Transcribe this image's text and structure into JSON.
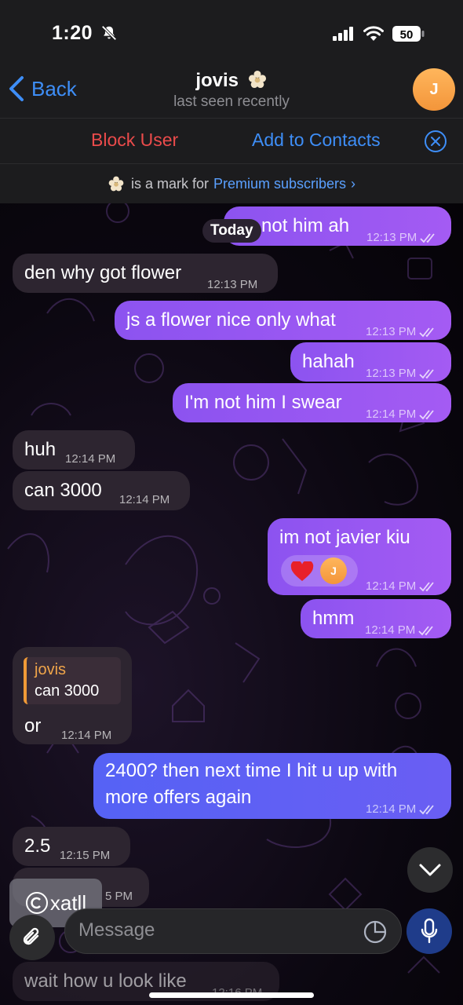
{
  "status_bar": {
    "time": "1:20",
    "battery": "50"
  },
  "header": {
    "back_label": "Back",
    "title": "jovis",
    "subtitle": "last seen recently",
    "avatar_initial": "J"
  },
  "actions": {
    "block": "Block User",
    "add": "Add to Contacts"
  },
  "premium": {
    "text": "is a mark for",
    "link": "Premium subscribers",
    "chevron": "›"
  },
  "chat": {
    "date_badge": "Today",
    "messages": [
      {
        "text": "not him ah",
        "time": "12:13 PM",
        "dir": "out"
      },
      {
        "text": "den why got flower",
        "time": "12:13 PM",
        "dir": "in"
      },
      {
        "text": "js a flower nice only what",
        "time": "12:13 PM",
        "dir": "out"
      },
      {
        "text": "hahah",
        "time": "12:13 PM",
        "dir": "out"
      },
      {
        "text": "I'm not him I swear",
        "time": "12:14 PM",
        "dir": "out"
      },
      {
        "text": "huh",
        "time": "12:14 PM",
        "dir": "in"
      },
      {
        "text": "can 3000",
        "time": "12:14 PM",
        "dir": "in"
      },
      {
        "text": "im not javier kiu",
        "time": "12:14 PM",
        "dir": "out",
        "reaction": "heart",
        "reaction_avatar": "J"
      },
      {
        "text": "hmm",
        "time": "12:14 PM",
        "dir": "out"
      },
      {
        "text": "or",
        "time": "12:14 PM",
        "dir": "in",
        "reply_to": {
          "name": "jovis",
          "text": "can 3000"
        }
      },
      {
        "text_line1": "2400? then next time I hit u up with",
        "text_line2": "more offers again",
        "time": "12:14 PM",
        "dir": "out"
      },
      {
        "text": "2.5",
        "time": "12:15 PM",
        "dir": "in"
      },
      {
        "text": "",
        "time": "5 PM",
        "dir": "in"
      },
      {
        "text": "wait how u look like",
        "time": "12:16 PM",
        "dir": "in"
      }
    ]
  },
  "watermark": {
    "text": "xatll"
  },
  "composer": {
    "placeholder": "Message"
  },
  "icons": {
    "back": "chevron-left-icon",
    "muted": "bell-slash-icon",
    "signal": "signal-icon",
    "wifi": "wifi-icon",
    "close": "close-circle-icon",
    "attach": "paperclip-icon",
    "sticker": "sticker-icon",
    "mic": "microphone-icon",
    "scroll": "chevron-down-icon",
    "premium": "flower-icon",
    "checks": "double-check-icon"
  },
  "colors": {
    "accent": "#3e8ef7",
    "danger": "#eb4b4b",
    "outgoing": "#9b57f2",
    "outgoing_blue": "#5c60f4",
    "incoming": "#2d2530"
  }
}
